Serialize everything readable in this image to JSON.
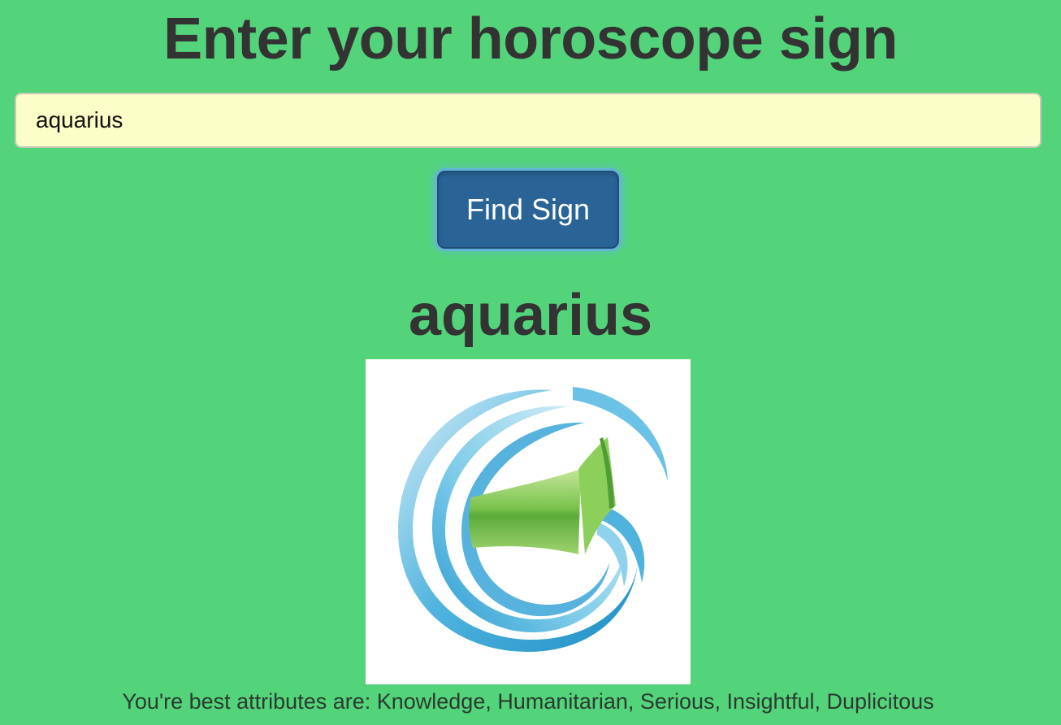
{
  "header": {
    "title": "Enter your horoscope sign"
  },
  "search": {
    "value": "aquarius",
    "placeholder": ""
  },
  "actions": {
    "find_label": "Find Sign"
  },
  "result": {
    "sign_name": "aquarius",
    "image_icon": "aquarius-symbol-icon",
    "attributes_text": "You're best attributes are: Knowledge, Humanitarian, Serious, Insightful, Duplicitous"
  },
  "colors": {
    "background": "#53d47b",
    "input_background": "#fbfec6",
    "button": "#2a6496",
    "text": "#333333"
  }
}
